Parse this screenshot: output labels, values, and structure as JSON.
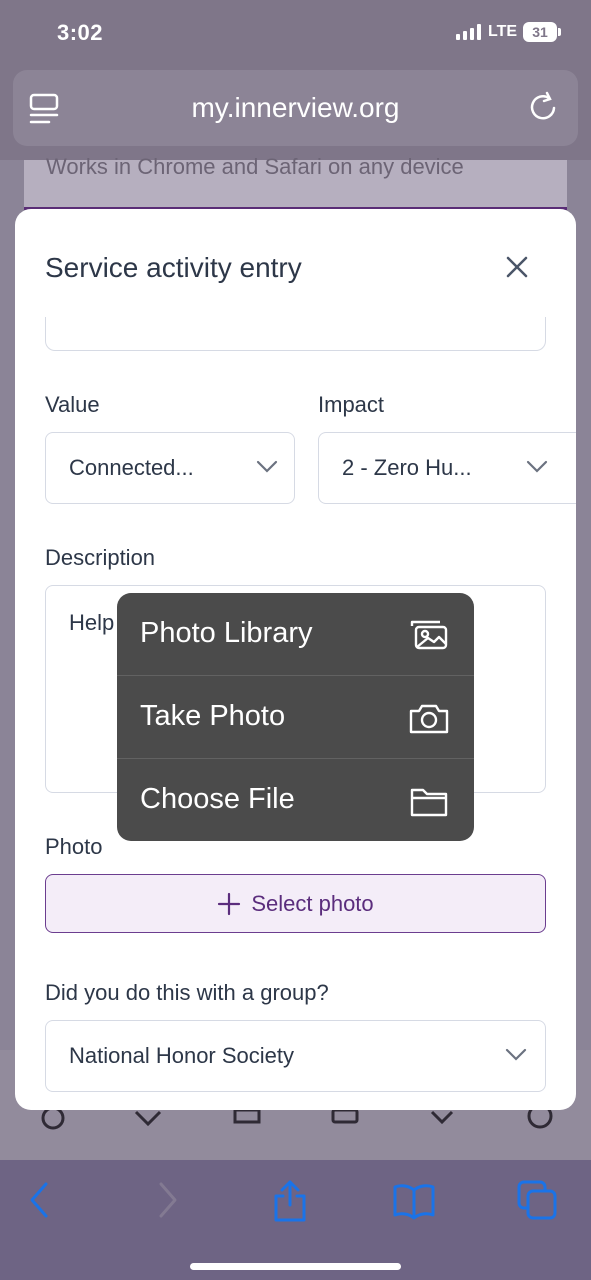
{
  "status_bar": {
    "time": "3:02",
    "network": "LTE",
    "battery": "31"
  },
  "browser": {
    "url": "my.innerview.org"
  },
  "background_page": {
    "tagline": "Works in Chrome and Safari on any device"
  },
  "modal": {
    "title": "Service activity entry",
    "value": {
      "label": "Value",
      "selected": "Connected..."
    },
    "impact": {
      "label": "Impact",
      "selected": "2 - Zero Hu..."
    },
    "description": {
      "label": "Description",
      "text": "Help"
    },
    "photo": {
      "label": "Photo",
      "button_label": "Select photo"
    },
    "group": {
      "label": "Did you do this with a group?",
      "selected": "National Honor Society"
    }
  },
  "photo_menu": {
    "items": [
      {
        "label": "Photo Library",
        "icon": "photo-library-icon"
      },
      {
        "label": "Take Photo",
        "icon": "camera-icon"
      },
      {
        "label": "Choose File",
        "icon": "folder-icon"
      }
    ]
  },
  "colors": {
    "accent": "#5b2d7d",
    "accent_bg": "#f4edf8",
    "safari_blue": "#1a73e8",
    "menu_bg": "#4b4b4b"
  }
}
